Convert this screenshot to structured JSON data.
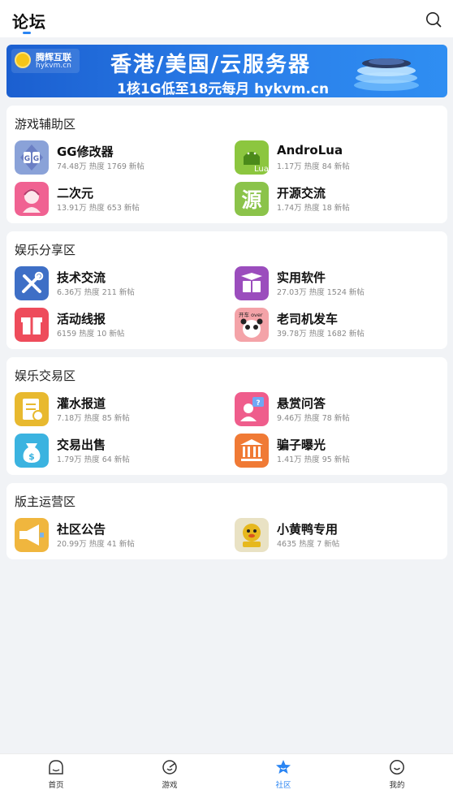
{
  "header": {
    "title": "论坛",
    "search_icon": "search-icon"
  },
  "banner": {
    "brand_name": "腾辉互联",
    "brand_url": "hykvm.cn",
    "headline": "香港/美国/云服务器",
    "subline": "1核1G低至18元每月 hykvm.cn"
  },
  "sections": [
    {
      "title": "游戏辅助区",
      "items": [
        {
          "name": "GG修改器",
          "meta": "74.48万 热度  1769 新帖",
          "icon": "gg-app-icon",
          "color": "#6f8bd6"
        },
        {
          "name": "AndroLua",
          "meta": "1.17万 热度  84 新帖",
          "icon": "androlua-icon",
          "color": "#8cc63f"
        },
        {
          "name": "二次元",
          "meta": "13.91万 热度  653 新帖",
          "icon": "anime-girl-icon",
          "color": "#f06292"
        },
        {
          "name": "开源交流",
          "meta": "1.74万 热度  18 新帖",
          "icon": "source-char-icon",
          "color": "#8bc34a"
        }
      ]
    },
    {
      "title": "娱乐分享区",
      "items": [
        {
          "name": "技术交流",
          "meta": "6.36万 热度  211 新帖",
          "icon": "tools-icon",
          "color": "#3e6fc6"
        },
        {
          "name": "实用软件",
          "meta": "27.03万 热度  1524 新帖",
          "icon": "box-icon",
          "color": "#9b4dbd"
        },
        {
          "name": "活动线报",
          "meta": "6159 热度  10 新帖",
          "icon": "gift-icon",
          "color": "#ee4c5b"
        },
        {
          "name": "老司机发车",
          "meta": "39.78万 热度  1682 新帖",
          "icon": "panda-meme-icon",
          "color": "#f4a3a8"
        }
      ]
    },
    {
      "title": "娱乐交易区",
      "items": [
        {
          "name": "灌水报道",
          "meta": "7.18万 热度  85 新帖",
          "icon": "document-clock-icon",
          "color": "#e8b92f"
        },
        {
          "name": "悬赏问答",
          "meta": "9.46万 热度  78 新帖",
          "icon": "question-user-icon",
          "color": "#ef5d8c"
        },
        {
          "name": "交易出售",
          "meta": "1.79万 热度  64 新帖",
          "icon": "money-bag-icon",
          "color": "#3bb3e0"
        },
        {
          "name": "骗子曝光",
          "meta": "1.41万 热度  95 新帖",
          "icon": "court-icon",
          "color": "#f07a35"
        }
      ]
    },
    {
      "title": "版主运营区",
      "items": [
        {
          "name": "社区公告",
          "meta": "20.99万 热度  41 新帖",
          "icon": "megaphone-icon",
          "color": "#f0b63e"
        },
        {
          "name": "小黄鸭专用",
          "meta": "4635 热度  7 新帖",
          "icon": "duck-icon",
          "color": "#e9e2c4"
        }
      ]
    }
  ],
  "tabbar": {
    "tabs": [
      {
        "label": "首页",
        "icon": "home-icon"
      },
      {
        "label": "游戏",
        "icon": "game-icon"
      },
      {
        "label": "社区",
        "icon": "community-star-icon",
        "active": true
      },
      {
        "label": "我的",
        "icon": "profile-smile-icon"
      }
    ],
    "accent": "#2a85f3"
  }
}
